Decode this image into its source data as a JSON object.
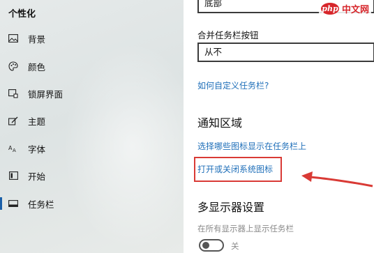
{
  "sidebar": {
    "title": "个性化",
    "items": [
      {
        "label": "背景",
        "icon": "image-icon"
      },
      {
        "label": "颜色",
        "icon": "palette-icon"
      },
      {
        "label": "锁屏界面",
        "icon": "lock-screen-icon"
      },
      {
        "label": "主题",
        "icon": "theme-brush-icon"
      },
      {
        "label": "字体",
        "icon": "font-icon"
      },
      {
        "label": "开始",
        "icon": "start-menu-icon"
      },
      {
        "label": "任务栏",
        "icon": "taskbar-icon",
        "active": true
      }
    ]
  },
  "content": {
    "taskbar_position_value": "底部",
    "combine_buttons_label": "合并任务栏按钮",
    "combine_buttons_value": "从不",
    "customize_link": "如何自定义任务栏?",
    "notification_title": "通知区域",
    "select_icons_link": "选择哪些图标显示在任务栏上",
    "system_icons_link": "打开或关闭系统图标",
    "multi_display_title": "多显示器设置",
    "show_all_displays_label": "在所有显示器上显示任务栏",
    "show_all_displays_state": "关"
  },
  "annotations": {
    "highlight_color": "#d93a35",
    "arrow_color": "#d93a35"
  },
  "watermark": {
    "logo": "php",
    "text": "中文网"
  },
  "colors": {
    "link": "#1f6fb9",
    "accent": "#1a5fa8"
  }
}
